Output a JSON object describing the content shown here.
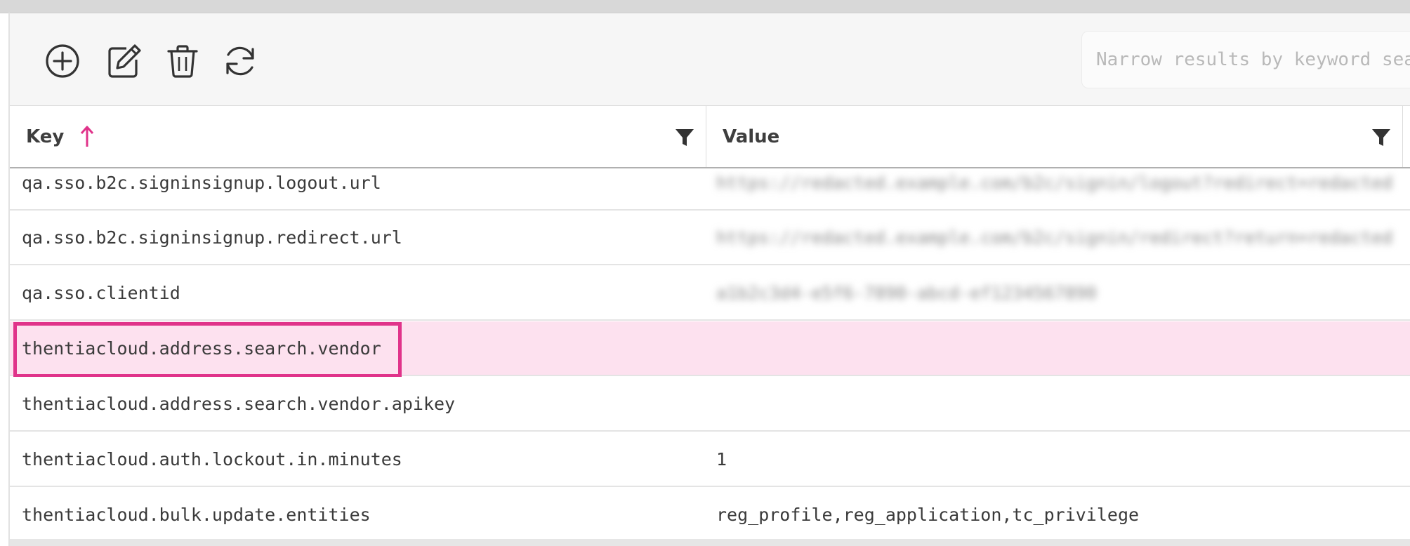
{
  "toolbar": {
    "icons": [
      "add-circle-icon",
      "edit-icon",
      "delete-icon",
      "refresh-icon"
    ],
    "search_placeholder": "Narrow results by keyword search"
  },
  "table": {
    "columns": [
      {
        "label": "Key",
        "sort": "ascending"
      },
      {
        "label": "Value"
      }
    ],
    "rows": [
      {
        "key": "qa.sso.b2c.signinsignup.logout.url",
        "value": "https://redacted.example.com/b2c/signin/logout?redirect=redacted",
        "value_blurred": true
      },
      {
        "key": "qa.sso.b2c.signinsignup.redirect.url",
        "value": "https://redacted.example.com/b2c/signin/redirect?return=redacted",
        "value_blurred": true
      },
      {
        "key": "qa.sso.clientid",
        "value": "a1b2c3d4-e5f6-7890-abcd-ef1234567890",
        "value_blurred": true
      },
      {
        "key": "thentiacloud.address.search.vendor",
        "value": "",
        "selected": true
      },
      {
        "key": "thentiacloud.address.search.vendor.apikey",
        "value": ""
      },
      {
        "key": "thentiacloud.auth.lockout.in.minutes",
        "value": "1"
      },
      {
        "key": "thentiacloud.bulk.update.entities",
        "value": "reg_profile,reg_application,tc_privilege"
      }
    ]
  },
  "colors": {
    "accent": "#e0338a",
    "selected_row": "#fde1ef",
    "toolbar_bg": "#f6f6f6"
  }
}
